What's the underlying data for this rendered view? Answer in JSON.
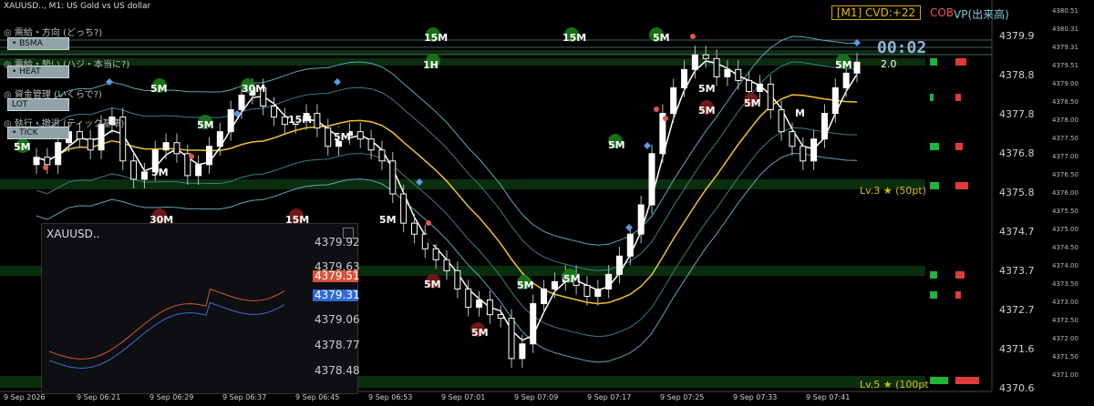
{
  "title": "XAUUSD.., M1:  US Gold vs US dollar",
  "status_box": "[M1] CVD:+22",
  "cob_label": "COB",
  "vp_label": "VP(出来高)",
  "countdown": "00:02",
  "countdown_sub": "2.0",
  "panel": {
    "rows": [
      {
        "label": "需給・方向 (どっち?)",
        "button": "• BSMA"
      },
      {
        "label": "需給・勢い (ハジ・本当に?)",
        "button": "• HEAT"
      },
      {
        "label": "資金管理 (いくらで?)",
        "button": "LOT"
      },
      {
        "label": "執行・撤退 (ティック基準)",
        "button": "• TICK"
      }
    ]
  },
  "level_labels": [
    {
      "text": "Lv.3 ★ (50pt)"
    },
    {
      "text": "Lv.5 ★ (100pt"
    }
  ],
  "tf_tags": [
    "30M",
    "15M",
    "5M",
    "1H",
    "15M",
    "5M",
    "5M",
    "30M",
    "15M",
    "5M",
    "5M",
    "15M",
    "5M",
    "5M",
    "5M",
    "5M",
    "5M",
    "5M",
    "5M",
    "5M",
    "5M",
    "5M",
    "5M",
    "M"
  ],
  "axis": {
    "prices_major": [
      "4379.9",
      "4378.8",
      "4377.8",
      "4376.8",
      "4375.8",
      "4374.7",
      "4373.7",
      "4372.7",
      "4371.6",
      "4370.6"
    ],
    "prices_minor": [
      "4380.51",
      "4380.31",
      "4379.31",
      "4379.51",
      "4379.00",
      "4378.50",
      "4378.00",
      "4377.50",
      "4377.00",
      "4376.50",
      "4376.00",
      "4375.50",
      "4375.00",
      "4374.50",
      "4374.00",
      "4373.50",
      "4373.00",
      "4372.50",
      "4372.00",
      "4371.50",
      "4371.00"
    ],
    "times": [
      "9 Sep 2026",
      "9 Sep 06:21",
      "9 Sep 06:29",
      "9 Sep 06:37",
      "9 Sep 06:45",
      "9 Sep 06:53",
      "9 Sep 07:01",
      "9 Sep 07:09",
      "9 Sep 07:17",
      "9 Sep 07:25",
      "9 Sep 07:33",
      "9 Sep 07:41"
    ]
  },
  "sub_window": {
    "name": "XAUUSD..",
    "prices": [
      "4379.92",
      "4379.63",
      "4379.06",
      "4378.77",
      "4378.48"
    ],
    "tag_red": "4379.51",
    "tag_blue": "4379.31"
  },
  "chart_data": {
    "type": "candlestick",
    "close_series": [
      4376.7,
      4376.5,
      4377.1,
      4377.4,
      4377.2,
      4376.9,
      4377.6,
      4377.8,
      4376.6,
      4376.1,
      4376.3,
      4376.9,
      4377.1,
      4376.8,
      4376.2,
      4376.5,
      4377.0,
      4377.4,
      4378.0,
      4378.4,
      4378.6,
      4378.1,
      4377.8,
      4377.6,
      4377.7,
      4377.9,
      4377.5,
      4377.0,
      4377.3,
      4377.4,
      4377.2,
      4376.9,
      4376.6,
      4375.7,
      4374.9,
      4374.6,
      4374.2,
      4373.9,
      4373.6,
      4373.1,
      4372.6,
      4372.8,
      4372.4,
      4372.3,
      4371.2,
      4371.6,
      4372.7,
      4373.1,
      4373.3,
      4373.5,
      4373.2,
      4372.9,
      4373.1,
      4373.5,
      4374.0,
      4374.6,
      4375.4,
      4376.8,
      4377.9,
      4378.6,
      4379.1,
      4379.5,
      4379.4,
      4378.9,
      4379.1,
      4378.8,
      4378.5,
      4378.7,
      4378.0,
      4377.4,
      4377.0,
      4376.6,
      4377.2,
      4377.9,
      4378.6,
      4379.0,
      4379.3
    ]
  }
}
